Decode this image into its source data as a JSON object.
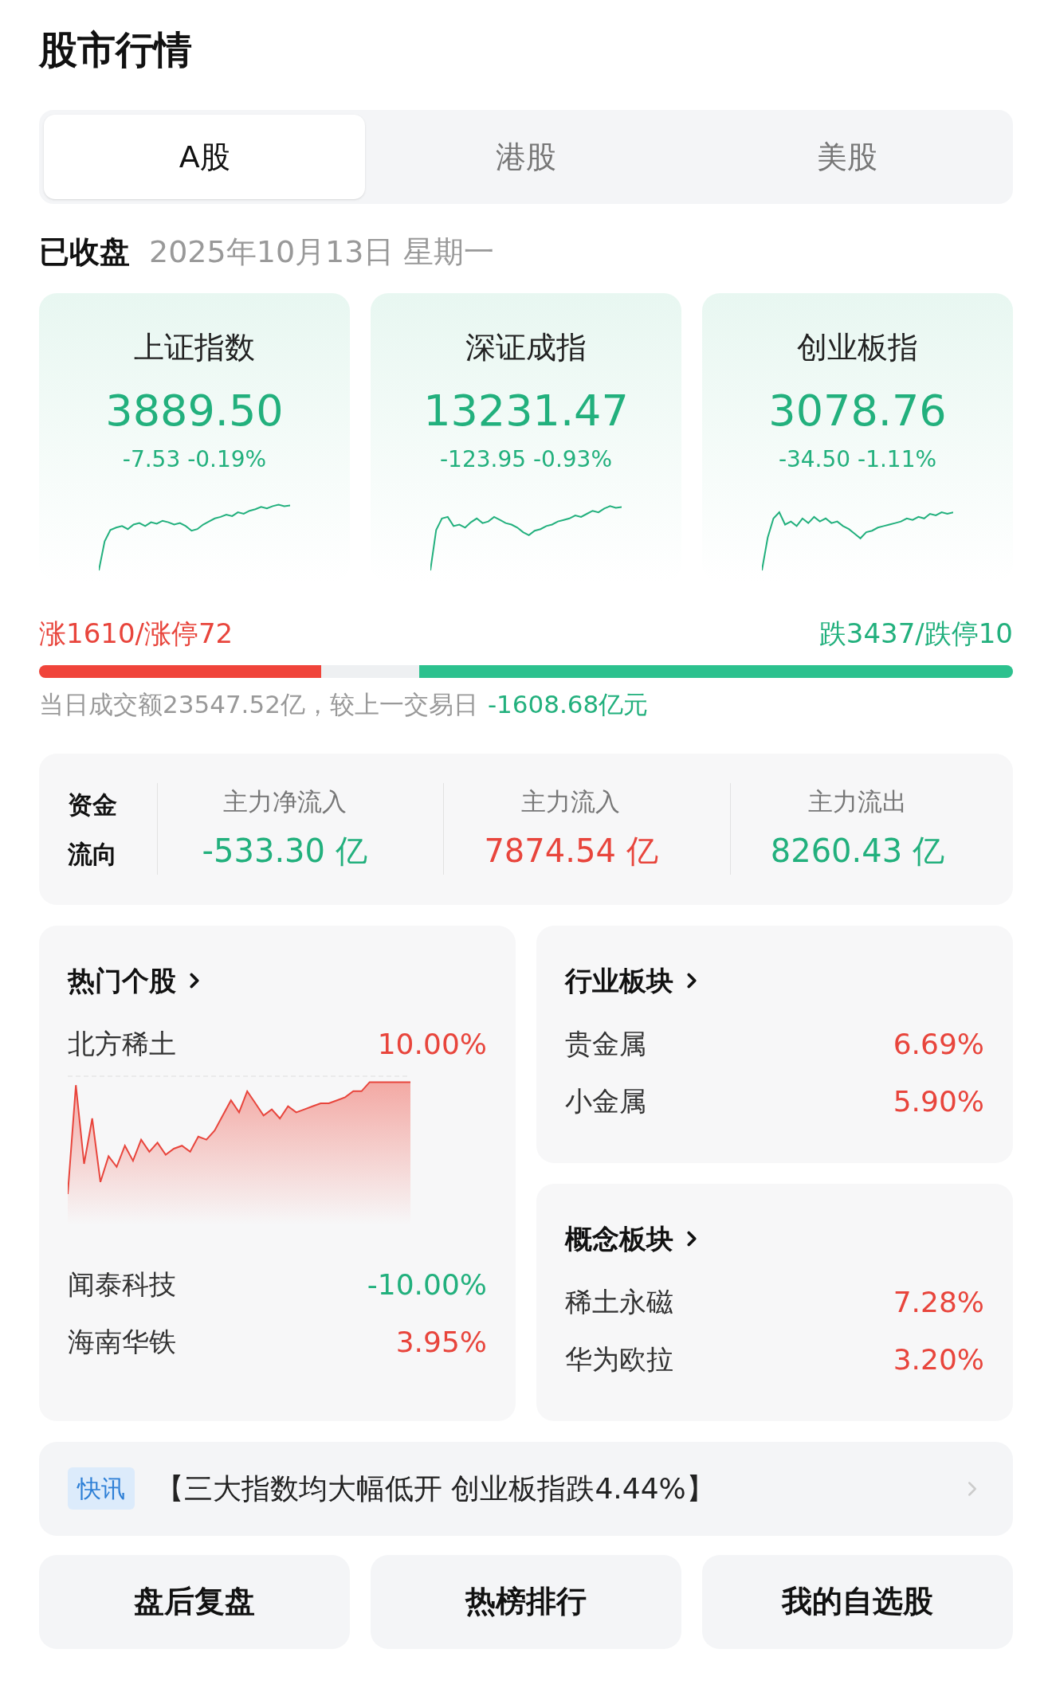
{
  "title": "股市行情",
  "tabs": [
    {
      "label": "A股",
      "selected": true
    },
    {
      "label": "港股",
      "selected": false
    },
    {
      "label": "美股",
      "selected": false
    }
  ],
  "market_status": {
    "state": "已收盘",
    "date": "2025年10月13日 星期一"
  },
  "indices": [
    {
      "name": "上证指数",
      "value": "3889.50",
      "change": "-7.53 -0.19%",
      "color": "#22b07d"
    },
    {
      "name": "深证成指",
      "value": "13231.47",
      "change": "-123.95 -0.93%",
      "color": "#22b07d"
    },
    {
      "name": "创业板指",
      "value": "3078.76",
      "change": "-34.50 -1.11%",
      "color": "#22b07d"
    }
  ],
  "breadth": {
    "up": {
      "label": "涨1610/涨停72",
      "level": 0.29
    },
    "down": {
      "label": "跌3437/跌停10",
      "level": 0.61
    }
  },
  "turnover": {
    "text": "当日成交额23547.52亿，较上一交易日",
    "change": "-1608.68亿元",
    "color": "#22b07d"
  },
  "fund_flow": {
    "title": "资金流向",
    "items": [
      {
        "label": "主力净流入",
        "value": "-533.30 亿",
        "color": "#22b07d"
      },
      {
        "label": "主力流入",
        "value": "7874.54 亿",
        "color": "#e8453c"
      },
      {
        "label": "主力流出",
        "value": "8260.43 亿",
        "color": "#22b07d"
      }
    ]
  },
  "hot_stocks": {
    "title": "热门个股",
    "top": {
      "name": "北方稀土",
      "change": "10.00%",
      "color": "#e8453c"
    },
    "rows": [
      {
        "name": "闻泰科技",
        "change": "-10.00%",
        "color": "#22b07d"
      },
      {
        "name": "海南华铁",
        "change": "3.95%",
        "color": "#e8453c"
      }
    ]
  },
  "sectors": [
    {
      "title": "行业板块",
      "rows": [
        {
          "name": "贵金属",
          "change": "6.69%",
          "color": "#e8453c"
        },
        {
          "name": "小金属",
          "change": "5.90%",
          "color": "#e8453c"
        }
      ]
    },
    {
      "title": "概念板块",
      "rows": [
        {
          "name": "稀土永磁",
          "change": "7.28%",
          "color": "#e8453c"
        },
        {
          "name": "华为欧拉",
          "change": "3.20%",
          "color": "#e8453c"
        }
      ]
    }
  ],
  "news": {
    "tag": "快讯",
    "text": "【三大指数均大幅低开 创业板指跌4.44%】"
  },
  "actions": [
    "盘后复盘",
    "热榜排行",
    "我的自选股"
  ]
}
